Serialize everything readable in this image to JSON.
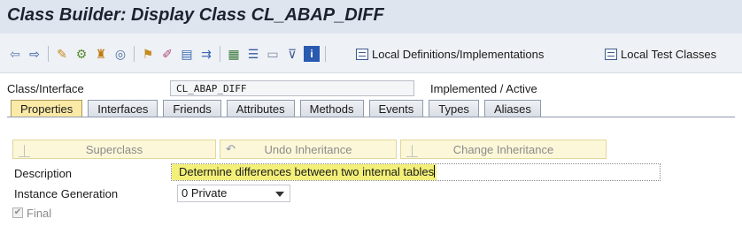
{
  "header": {
    "title": "Class Builder: Display Class CL_ABAP_DIFF"
  },
  "toolbar": {
    "icons": [
      "back-arrow-icon",
      "forward-arrow-icon",
      "other-object-icon",
      "change-display-icon",
      "activate-icon",
      "test-icon",
      "where-used-icon",
      "object-list-icon",
      "navigation-icon",
      "hierarchy-icon",
      "layout-icon",
      "window-icon",
      "filter-icon",
      "info-icon"
    ],
    "local_definitions_label": "Local Definitions/Implementations",
    "local_test_classes_label": "Local Test Classes"
  },
  "class_row": {
    "label": "Class/Interface",
    "value": "CL_ABAP_DIFF",
    "status": "Implemented / Active"
  },
  "tabs": [
    {
      "label": "Properties",
      "active": true
    },
    {
      "label": "Interfaces",
      "active": false
    },
    {
      "label": "Friends",
      "active": false
    },
    {
      "label": "Attributes",
      "active": false
    },
    {
      "label": "Methods",
      "active": false
    },
    {
      "label": "Events",
      "active": false
    },
    {
      "label": "Types",
      "active": false
    },
    {
      "label": "Aliases",
      "active": false
    }
  ],
  "actions": {
    "superclass_label": "Superclass",
    "undo_inheritance_label": "Undo Inheritance",
    "change_inheritance_label": "Change Inheritance"
  },
  "properties": {
    "description_label": "Description",
    "description_value": "Determine differences between two internal tables",
    "instance_generation_label": "Instance Generation",
    "instance_generation_value": "0 Private",
    "final_label": "Final",
    "final_checked": true
  },
  "colors": {
    "title_bar": "#dfe5ef",
    "active_tab": "#fbe9a6",
    "highlight": "#f3f079",
    "action_button": "#fcf7d8"
  }
}
